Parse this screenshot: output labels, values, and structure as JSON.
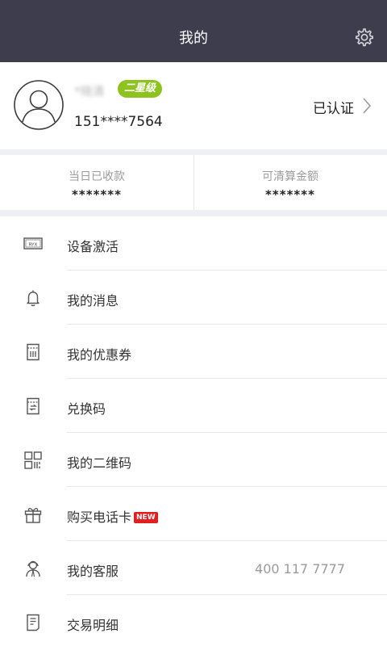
{
  "header": {
    "title": "我的",
    "settings_icon": "gear-icon"
  },
  "profile": {
    "name": "*晓清",
    "level": "二星级",
    "phone": "151****7564",
    "verified": "已认证",
    "colors": {
      "level_badge": "#8ec31f"
    }
  },
  "stats": [
    {
      "label": "当日已收款",
      "value": "*******"
    },
    {
      "label": "可清算金额",
      "value": "*******"
    }
  ],
  "menu": [
    {
      "label": "设备激活",
      "icon": "device-icon"
    },
    {
      "label": "我的消息",
      "icon": "bell-icon"
    },
    {
      "label": "我的优惠券",
      "icon": "coupon-icon"
    },
    {
      "label": "兑换码",
      "icon": "voucher-icon"
    },
    {
      "label": "我的二维码",
      "icon": "qrcode-icon"
    },
    {
      "label": "购买电话卡",
      "icon": "gift-icon",
      "badge": "NEW"
    },
    {
      "label": "我的客服",
      "icon": "customer-service-icon",
      "extra": "400 117 7777"
    },
    {
      "label": "交易明细",
      "icon": "receipt-icon"
    }
  ],
  "device_icon_text": "RYX",
  "colors": {
    "header_bg": "#3e3d4e",
    "badge_new": "#e02020"
  }
}
